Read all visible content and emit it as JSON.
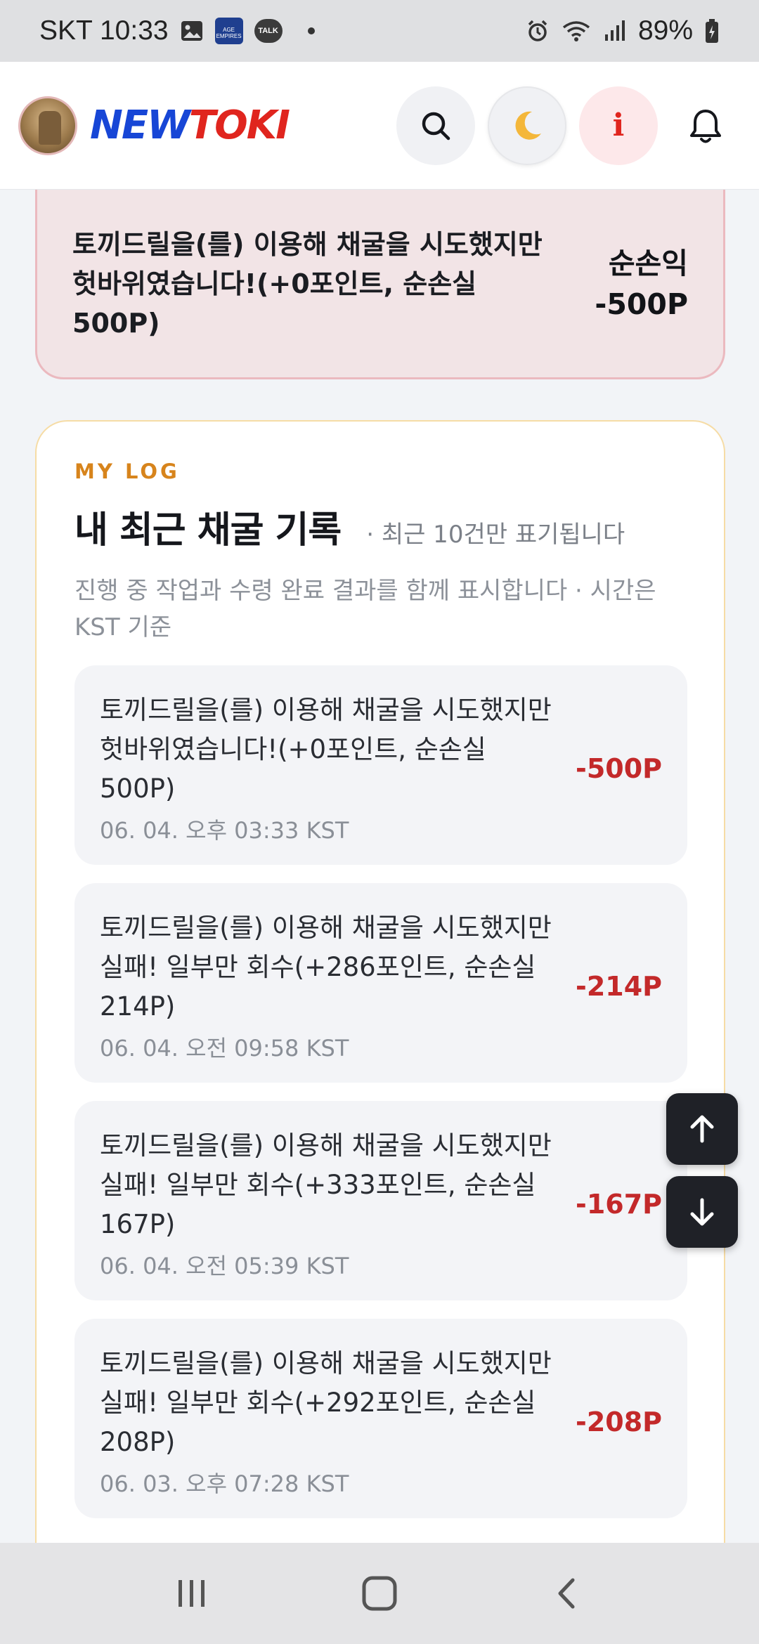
{
  "status_bar": {
    "carrier_time": "SKT 10:33",
    "age_icon_text": "AGE EMPIRES",
    "talk_icon_text": "TALK",
    "battery": "89%"
  },
  "header": {
    "logo_new": "NEW",
    "logo_toki": "TOKI",
    "info_glyph": "i"
  },
  "alert": {
    "message": "토끼드릴을(를) 이용해 채굴을 시도했지만 헛바위였습니다!(+0포인트, 순손실 500P)",
    "net_label": "순손익",
    "net_value": "-500P"
  },
  "log": {
    "kicker": "MY LOG",
    "title": "내 최근 채굴 기록",
    "note": "· 최근 10건만 표기됩니다",
    "description": "진행 중 작업과 수령 완료 결과를 함께 표시합니다 · 시간은 KST 기준",
    "entries": [
      {
        "text": "토끼드릴을(를) 이용해 채굴을 시도했지만 헛바위였습니다!(+0포인트, 순손실 500P)",
        "time": "06. 04. 오후 03:33 KST",
        "amount": "-500P"
      },
      {
        "text": "토끼드릴을(를) 이용해 채굴을 시도했지만 실패! 일부만 회수(+286포인트, 순손실 214P)",
        "time": "06. 04. 오전 09:58 KST",
        "amount": "-214P"
      },
      {
        "text": "토끼드릴을(를) 이용해 채굴을 시도했지만 실패! 일부만 회수(+333포인트, 순손실 167P)",
        "time": "06. 04. 오전 05:39 KST",
        "amount": "-167P"
      },
      {
        "text": "토끼드릴을(를) 이용해 채굴을 시도했지만 실패! 일부만 회수(+292포인트, 순손실 208P)",
        "time": "06. 03. 오후 07:28 KST",
        "amount": "-208P"
      }
    ]
  },
  "colors": {
    "accent_orange": "#d7841c",
    "loss_red": "#c3292a",
    "logo_blue": "#1746d6",
    "logo_red": "#e0251e"
  },
  "icons": [
    "search-icon",
    "moon-icon",
    "info-icon",
    "bell-icon",
    "arrow-up-icon",
    "arrow-down-icon",
    "recents-icon",
    "home-icon",
    "back-icon"
  ]
}
